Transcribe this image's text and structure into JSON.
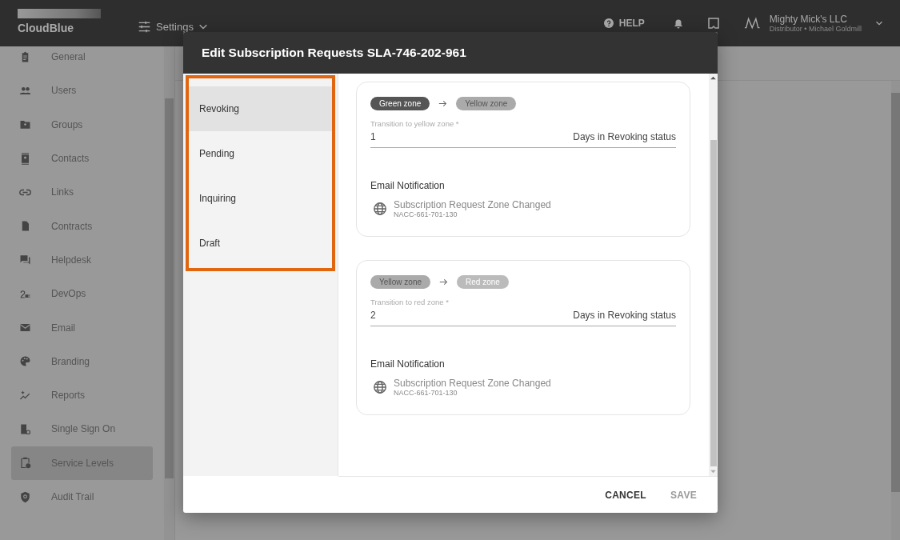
{
  "app": {
    "logo": "CloudBlue",
    "menu": "Settings",
    "help": "HELP",
    "account": {
      "name": "Mighty Mick's LLC",
      "details": "Distributor • Michael Goldmill"
    }
  },
  "sidebar": {
    "items": [
      {
        "label": "General",
        "selected": false
      },
      {
        "label": "Users",
        "selected": false
      },
      {
        "label": "Groups",
        "selected": false
      },
      {
        "label": "Contacts",
        "selected": false
      },
      {
        "label": "Links",
        "selected": false
      },
      {
        "label": "Contracts",
        "selected": false
      },
      {
        "label": "Helpdesk",
        "selected": false
      },
      {
        "label": "DevOps",
        "selected": false
      },
      {
        "label": "Email",
        "selected": false
      },
      {
        "label": "Branding",
        "selected": false
      },
      {
        "label": "Reports",
        "selected": false
      },
      {
        "label": "Single Sign On",
        "selected": false
      },
      {
        "label": "Service Levels",
        "selected": true
      },
      {
        "label": "Audit Trail",
        "selected": false
      }
    ]
  },
  "dialog": {
    "title": "Edit Subscription Requests SLA-746-202-961",
    "statuses": [
      {
        "label": "Revoking",
        "selected": true
      },
      {
        "label": "Pending",
        "selected": false
      },
      {
        "label": "Inquiring",
        "selected": false
      },
      {
        "label": "Draft",
        "selected": false
      }
    ],
    "transitions": [
      {
        "from": {
          "label": "Green zone",
          "kind": "green"
        },
        "to": {
          "label": "Yellow zone",
          "kind": "yellow"
        },
        "field": {
          "label": "Transition to yellow zone *",
          "value": "1",
          "suffix": "Days in Revoking status"
        },
        "notification": {
          "heading": "Email Notification",
          "title": "Subscription Request Zone Changed",
          "id": "NACC-661-701-130"
        }
      },
      {
        "from": {
          "label": "Yellow zone",
          "kind": "yellow"
        },
        "to": {
          "label": "Red zone",
          "kind": "red"
        },
        "field": {
          "label": "Transition to red zone *",
          "value": "2",
          "suffix": "Days in Revoking status"
        },
        "notification": {
          "heading": "Email Notification",
          "title": "Subscription Request Zone Changed",
          "id": "NACC-661-701-130"
        }
      }
    ],
    "buttons": [
      {
        "label": "CANCEL",
        "disabled": false
      },
      {
        "label": "SAVE",
        "disabled": true
      }
    ]
  }
}
